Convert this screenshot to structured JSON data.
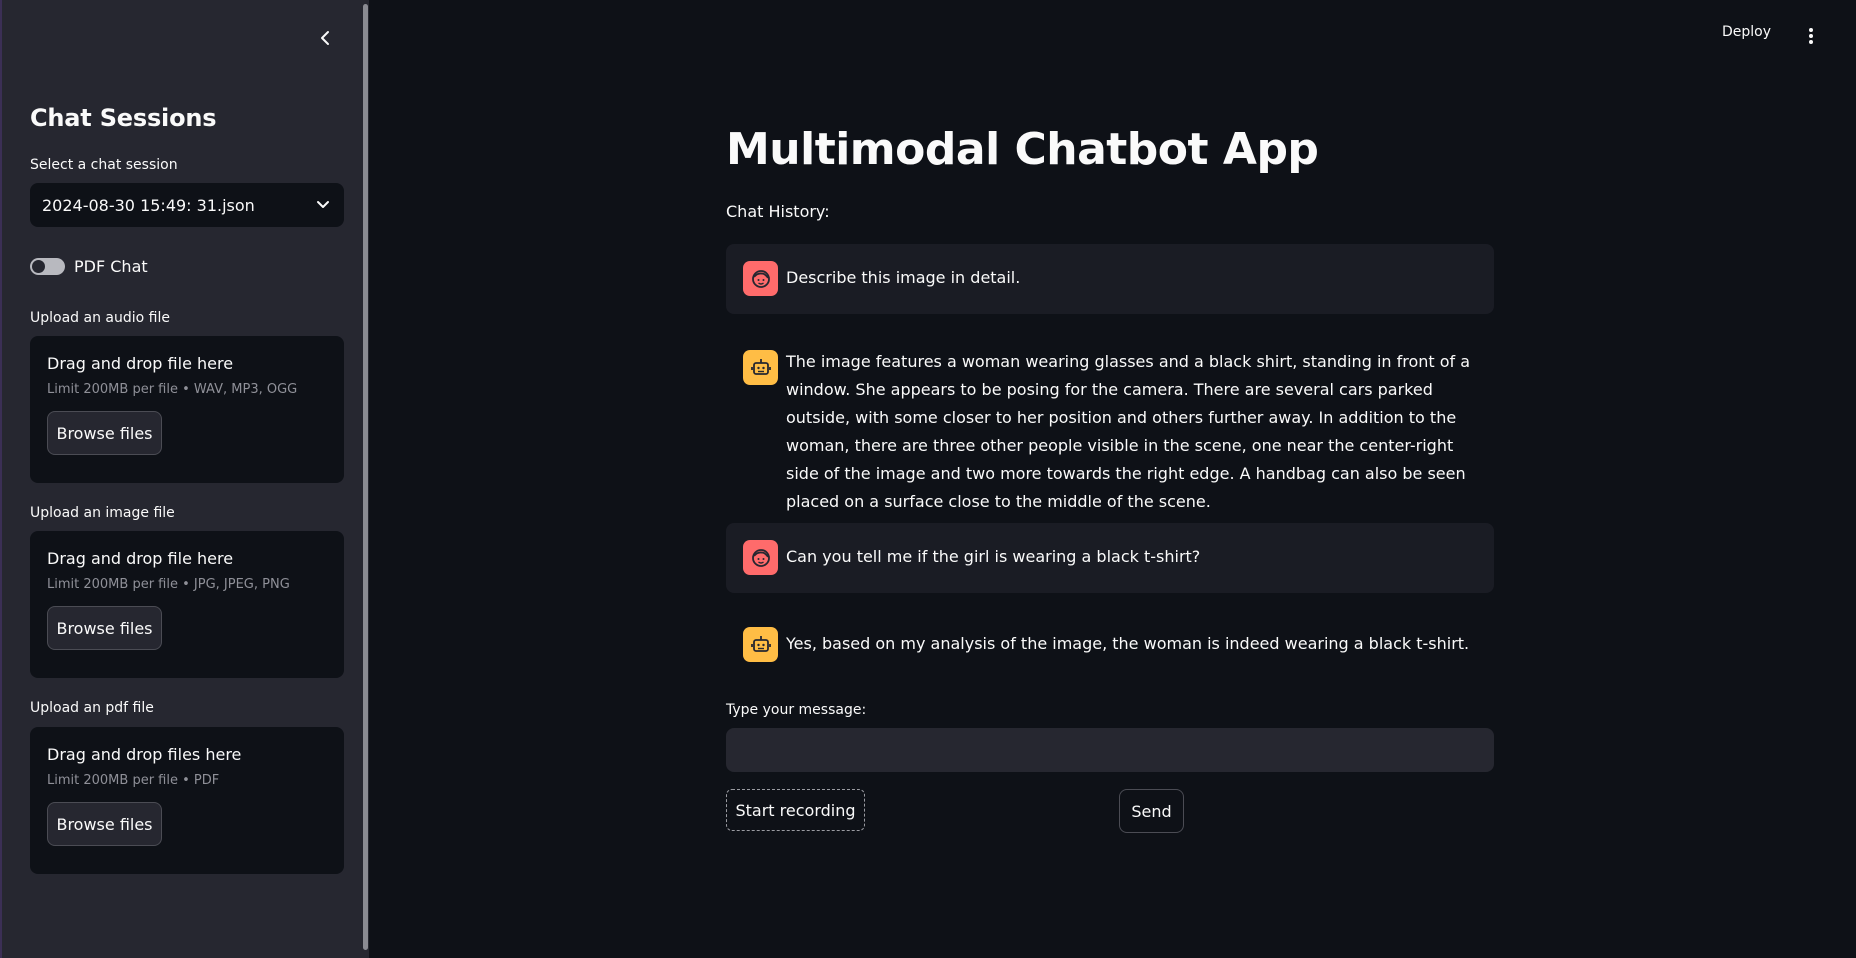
{
  "sidebar": {
    "title": "Chat Sessions",
    "session_label": "Select a chat session",
    "session_value": "2024-08-30 15:49: 31.json",
    "pdf_toggle_label": "PDF Chat",
    "pdf_toggle_on": false,
    "audio": {
      "label": "Upload an audio file",
      "drop_text": "Drag and drop file here",
      "limit": "Limit 200MB per file • WAV, MP3, OGG",
      "button": "Browse files"
    },
    "image": {
      "label": "Upload an image file",
      "drop_text": "Drag and drop file here",
      "limit": "Limit 200MB per file • JPG, JPEG, PNG",
      "button": "Browse files"
    },
    "pdf": {
      "label": "Upload an pdf file",
      "drop_text": "Drag and drop files here",
      "limit": "Limit 200MB per file • PDF",
      "button": "Browse files"
    }
  },
  "header": {
    "deploy_label": "Deploy"
  },
  "main": {
    "title": "Multimodal Chatbot App",
    "history_label": "Chat History:",
    "messages": [
      {
        "role": "user",
        "text": "Describe this image in detail."
      },
      {
        "role": "assistant",
        "text": "The image features a woman wearing glasses and a black shirt, standing in front of a window. She appears to be posing for the camera. There are several cars parked outside, with some closer to her position and others further away. In addition to the woman, there are three other people visible in the scene, one near the center-right side of the image and two more towards the right edge. A handbag can also be seen placed on a surface close to the middle of the scene."
      },
      {
        "role": "user",
        "text": "Can you tell me if the girl is wearing a black t-shirt?"
      },
      {
        "role": "assistant",
        "text": "Yes, based on my analysis of the image, the woman is indeed wearing a black t-shirt."
      }
    ],
    "input_label": "Type your message:",
    "input_value": "",
    "record_button": "Start recording",
    "send_button": "Send"
  },
  "colors": {
    "background": "#0e1117",
    "sidebar": "#262730",
    "user_avatar": "#ff6b6b",
    "bot_avatar": "#ffbd45",
    "user_message_bg": "#1a1c24"
  },
  "icons": {
    "collapse": "chevron-left-icon",
    "select": "chevron-down-icon",
    "menu": "kebab-menu-icon",
    "user_avatar": "user-face-icon",
    "bot_avatar": "robot-icon"
  }
}
